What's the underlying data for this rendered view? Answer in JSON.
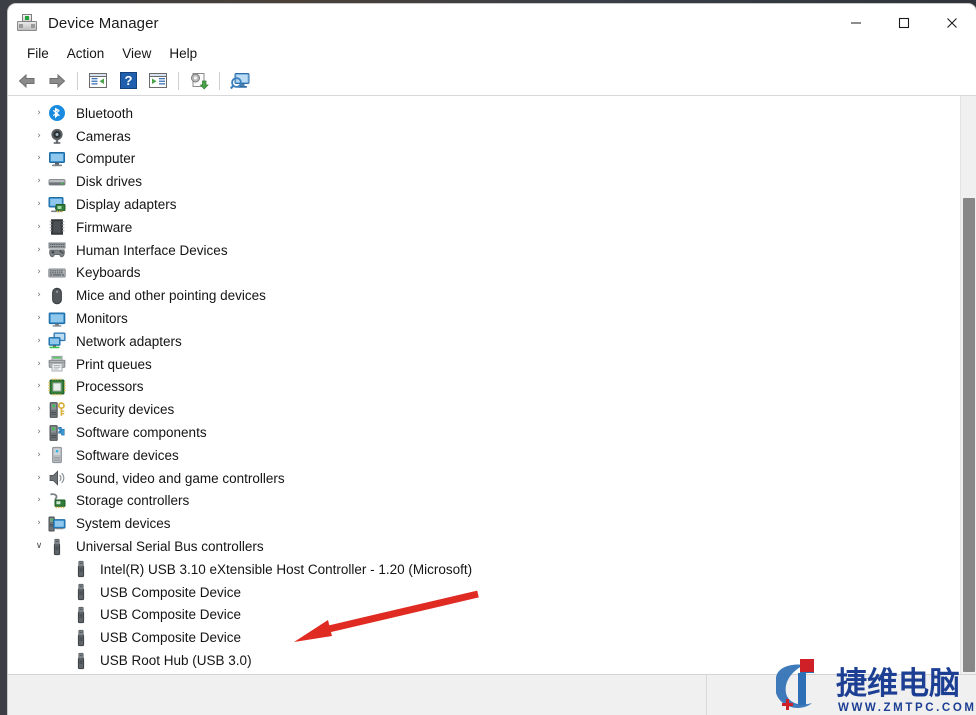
{
  "window": {
    "title": "Device Manager",
    "icon": "device-manager-icon",
    "controls": {
      "minimize": "—",
      "maximize": "☐",
      "close": "✕"
    }
  },
  "menubar": {
    "items": [
      {
        "label": "File"
      },
      {
        "label": "Action"
      },
      {
        "label": "View"
      },
      {
        "label": "Help"
      }
    ]
  },
  "toolbar": {
    "buttons": [
      {
        "name": "back-button",
        "icon": "left-arrow-icon"
      },
      {
        "name": "forward-button",
        "icon": "right-arrow-icon"
      },
      {
        "name": "show-hide-console-tree-button",
        "icon": "panel-left-icon"
      },
      {
        "name": "help-button",
        "icon": "question-mark-icon"
      },
      {
        "name": "properties-button",
        "icon": "panel-right-icon"
      },
      {
        "name": "update-driver-button",
        "icon": "driver-update-icon"
      },
      {
        "name": "scan-for-hardware-changes-button",
        "icon": "scan-monitor-icon"
      }
    ]
  },
  "tree": {
    "nodes": [
      {
        "label": "Bluetooth",
        "icon": "bluetooth-icon",
        "state": "collapsed",
        "level": 1
      },
      {
        "label": "Cameras",
        "icon": "camera-icon",
        "state": "collapsed",
        "level": 1
      },
      {
        "label": "Computer",
        "icon": "computer-icon",
        "state": "collapsed",
        "level": 1
      },
      {
        "label": "Disk drives",
        "icon": "disk-drive-icon",
        "state": "collapsed",
        "level": 1
      },
      {
        "label": "Display adapters",
        "icon": "display-adapter-icon",
        "state": "collapsed",
        "level": 1
      },
      {
        "label": "Firmware",
        "icon": "firmware-chip-icon",
        "state": "collapsed",
        "level": 1
      },
      {
        "label": "Human Interface Devices",
        "icon": "gamepad-icon",
        "state": "collapsed",
        "level": 1
      },
      {
        "label": "Keyboards",
        "icon": "keyboard-icon",
        "state": "collapsed",
        "level": 1
      },
      {
        "label": "Mice and other pointing devices",
        "icon": "mouse-icon",
        "state": "collapsed",
        "level": 1
      },
      {
        "label": "Monitors",
        "icon": "monitor-icon",
        "state": "collapsed",
        "level": 1
      },
      {
        "label": "Network adapters",
        "icon": "network-adapter-icon",
        "state": "collapsed",
        "level": 1
      },
      {
        "label": "Print queues",
        "icon": "printer-icon",
        "state": "collapsed",
        "level": 1
      },
      {
        "label": "Processors",
        "icon": "processor-icon",
        "state": "collapsed",
        "level": 1
      },
      {
        "label": "Security devices",
        "icon": "security-device-icon",
        "state": "collapsed",
        "level": 1
      },
      {
        "label": "Software components",
        "icon": "software-component-icon",
        "state": "collapsed",
        "level": 1
      },
      {
        "label": "Software devices",
        "icon": "software-device-icon",
        "state": "collapsed",
        "level": 1
      },
      {
        "label": "Sound, video and game controllers",
        "icon": "speaker-icon",
        "state": "collapsed",
        "level": 1
      },
      {
        "label": "Storage controllers",
        "icon": "storage-controller-icon",
        "state": "collapsed",
        "level": 1
      },
      {
        "label": "System devices",
        "icon": "system-device-icon",
        "state": "collapsed",
        "level": 1
      },
      {
        "label": "Universal Serial Bus controllers",
        "icon": "usb-icon",
        "state": "expanded",
        "level": 1
      },
      {
        "label": "Intel(R) USB 3.10 eXtensible Host Controller - 1.20 (Microsoft)",
        "icon": "usb-icon",
        "state": "leaf",
        "level": 2
      },
      {
        "label": "USB Composite Device",
        "icon": "usb-icon",
        "state": "leaf",
        "level": 2
      },
      {
        "label": "USB Composite Device",
        "icon": "usb-icon",
        "state": "leaf",
        "level": 2
      },
      {
        "label": "USB Composite Device",
        "icon": "usb-icon",
        "state": "leaf",
        "level": 2
      },
      {
        "label": "USB Root Hub (USB 3.0)",
        "icon": "usb-icon",
        "state": "leaf",
        "level": 2
      }
    ],
    "chevron_collapsed": "›",
    "chevron_expanded": "∨"
  },
  "statusbar": {
    "text": ""
  },
  "annotation": {
    "type": "arrow",
    "color": "#e02b23",
    "points_to": "Universal Serial Bus controllers"
  },
  "watermark": {
    "brand_cn": "捷维电脑",
    "url": "WWW.ZMTPC.COM",
    "logo_blue": "#2f6fb5",
    "logo_red": "#cf2027",
    "text_blue": "#1c3f94"
  },
  "colors": {
    "window_bg": "#ffffff",
    "chrome_bg": "#ffffff",
    "status_bg": "#f0f0f0",
    "scrollbar_track": "#f0f0f0",
    "scrollbar_thumb": "#878787",
    "text": "#141414",
    "accent_blue": "#0078d4"
  }
}
